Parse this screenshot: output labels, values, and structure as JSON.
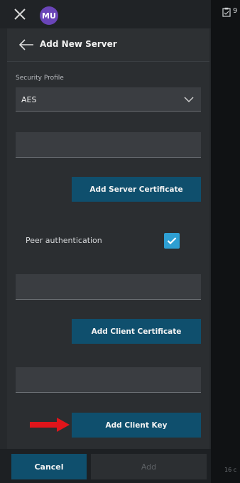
{
  "topbar": {
    "close_icon": "close-icon",
    "avatar_initials": "MU"
  },
  "header": {
    "back_icon": "arrow-left-icon",
    "title": "Add New Server"
  },
  "form": {
    "security_profile_label": "Security Profile",
    "security_profile_value": "AES",
    "server_certificate_value": "",
    "add_server_certificate_label": "Add Server Certificate",
    "peer_authentication_label": "Peer authentication",
    "peer_authentication_checked": true,
    "client_certificate_value": "",
    "add_client_certificate_label": "Add Client Certificate",
    "client_key_value": "",
    "add_client_key_label": "Add Client Key"
  },
  "annotation": {
    "arrow_icon": "red-arrow-icon",
    "arrow_color": "#e0151b"
  },
  "footer": {
    "cancel_label": "Cancel",
    "add_label": "Add"
  },
  "background": {
    "top_number": "9",
    "bottom_text": "16 c"
  },
  "colors": {
    "primary_button": "#0f4f6d",
    "checkbox": "#2e9fd3",
    "avatar": "#6a45b8"
  }
}
